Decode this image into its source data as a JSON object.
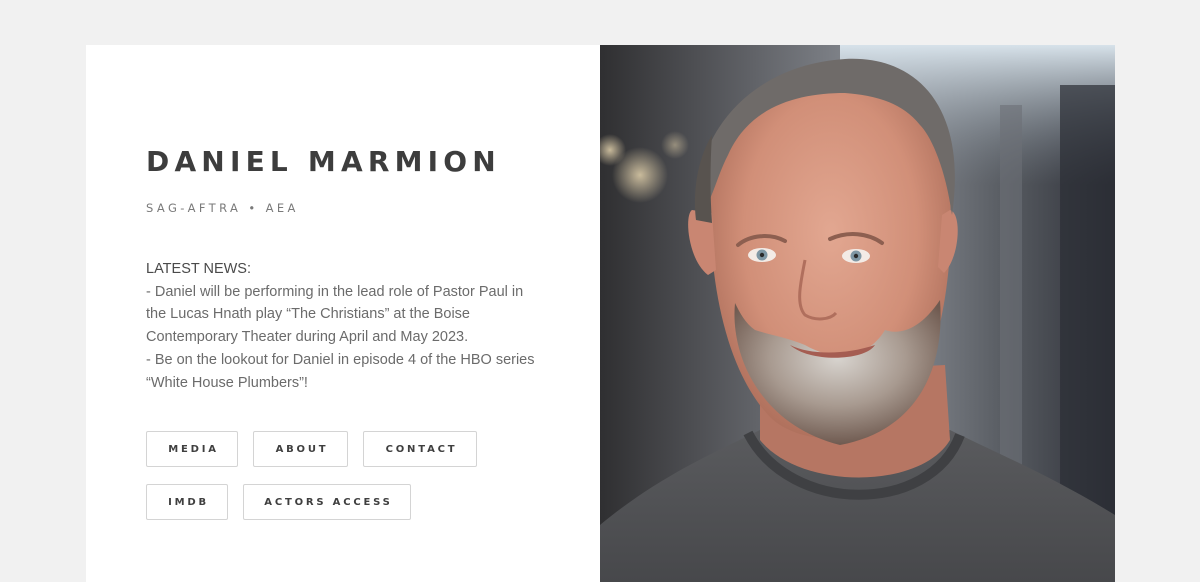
{
  "profile": {
    "name": "DANIEL MARMION",
    "unions": "SAG-AFTRA • AEA"
  },
  "news": {
    "heading": "LATEST NEWS:",
    "lines": [
      "- Daniel will be performing in the lead role of Pastor Paul in the Lucas Hnath play “The Christians” at the Boise Contemporary Theater during April and May 2023.",
      "- Be on the lookout for Daniel in episode 4 of the HBO series “White House Plumbers”!"
    ]
  },
  "buttons": {
    "media": "MEDIA",
    "about": "ABOUT",
    "contact": "CONTACT",
    "imdb": "IMDB",
    "actors_access": "ACTORS ACCESS"
  },
  "colors": {
    "page_background": "#f1f1f1",
    "card_background": "#ffffff",
    "heading_text": "#3d3d3d",
    "body_text": "#6b6b6b",
    "button_border": "#d4d4d4"
  }
}
